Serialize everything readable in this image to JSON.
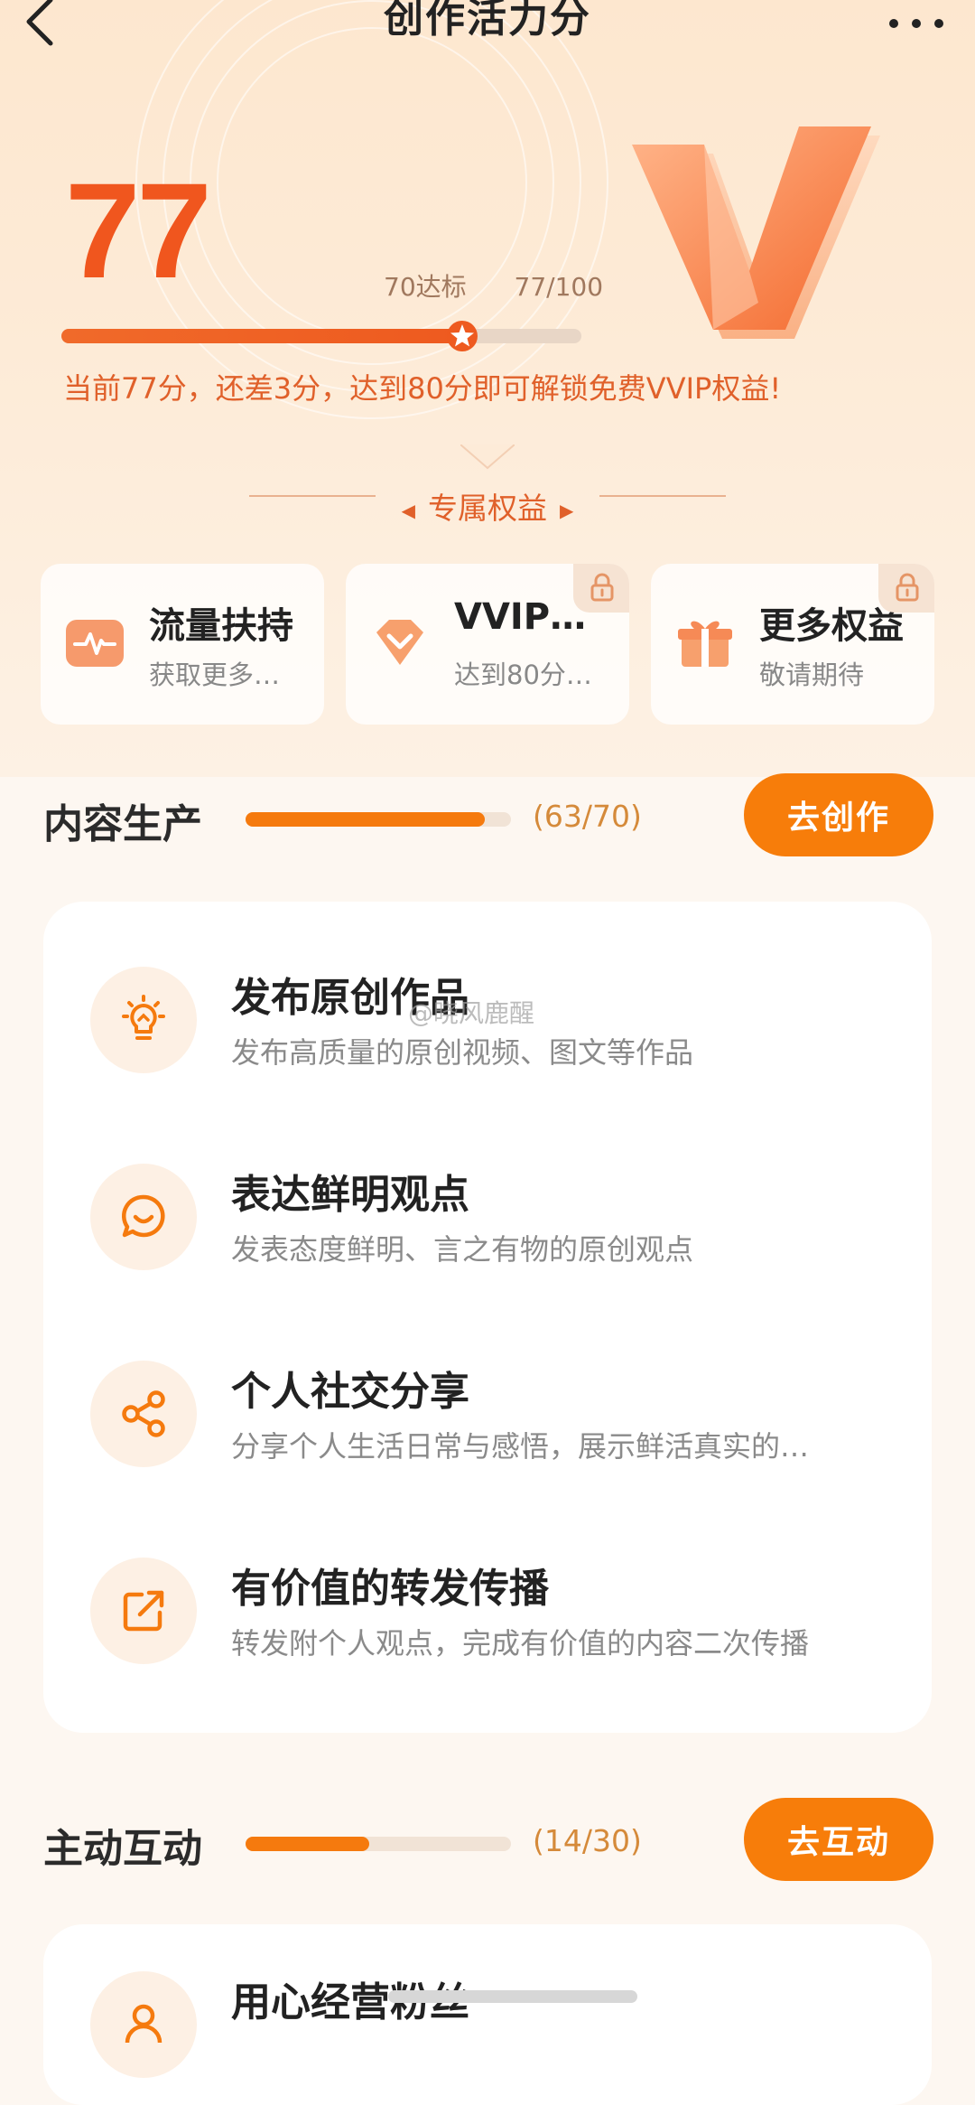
{
  "header": {
    "title": "创作活力分"
  },
  "score": {
    "value": "77",
    "threshold_label": "70达标",
    "ratio_label": "77/100",
    "progress": 0.77,
    "message": "当前77分，还差3分，达到80分即可解锁免费VVIP权益!"
  },
  "rights": {
    "title": "专属权益",
    "items": [
      {
        "name": "流量扶持",
        "desc": "获取更多…",
        "icon": "heartbeat-icon",
        "locked": false
      },
      {
        "name": "VVIP…",
        "desc": "达到80分…",
        "icon": "diamond-icon",
        "locked": true
      },
      {
        "name": "更多权益",
        "desc": "敬请期待",
        "icon": "gift-icon",
        "locked": true
      }
    ]
  },
  "sections": [
    {
      "name": "内容生产",
      "count": "(63/70)",
      "progress": 0.9,
      "button": "去创作",
      "tasks": [
        {
          "name": "发布原创作品",
          "desc": "发布高质量的原创视频、图文等作品",
          "icon": "lightbulb-icon"
        },
        {
          "name": "表达鲜明观点",
          "desc": "发表态度鲜明、言之有物的原创观点",
          "icon": "chat-bubble-icon"
        },
        {
          "name": "个人社交分享",
          "desc": "分享个人生活日常与感悟，展示鲜活真实的…",
          "icon": "share-icon"
        },
        {
          "name": "有价值的转发传播",
          "desc": "转发附个人观点，完成有价值的内容二次传播",
          "icon": "forward-icon"
        }
      ]
    },
    {
      "name": "主动互动",
      "count": "(14/30)",
      "progress": 0.4667,
      "button": "去互动",
      "tasks": [
        {
          "name": "用心经营粉丝",
          "icon": "user-heart-icon"
        }
      ]
    }
  ],
  "watermark": "@晓风鹿醒",
  "colors": {
    "accent": "#f77d0a",
    "score": "#f0561e",
    "hint": "#e0602a"
  }
}
